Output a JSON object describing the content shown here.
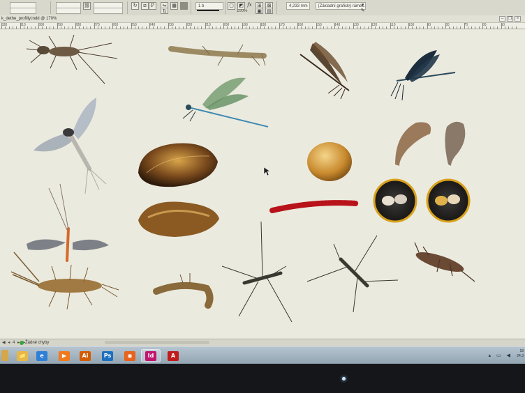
{
  "control_bar": {
    "stroke_weight": "1 b",
    "zoom_percent": "100%",
    "dimension": "4,233 mm",
    "frame_style": "[Základní grafický rámeč..."
  },
  "document": {
    "tab_title": "k_dethe_profilly.indd @ 170%"
  },
  "ruler": {
    "labels": [
      "330",
      "310",
      "300",
      "290",
      "280",
      "270",
      "260",
      "250",
      "240",
      "230",
      "220",
      "210",
      "200",
      "190",
      "180",
      "170",
      "160",
      "150",
      "140",
      "130",
      "120",
      "110",
      "100",
      "90",
      "80",
      "70",
      "60",
      "50"
    ]
  },
  "status": {
    "nav_arrows": "◀ ◂ 4 ▸ ▶",
    "preflight_label": "Žádné chyby"
  },
  "taskbar": {
    "apps": [
      {
        "name": "windows-explorer",
        "label": "📁",
        "color": "#e6b74a"
      },
      {
        "name": "internet-explorer",
        "label": "e",
        "color": "#2f7fd6"
      },
      {
        "name": "media-player",
        "label": "▶",
        "color": "#f07a1e"
      },
      {
        "name": "illustrator",
        "label": "Ai",
        "color": "#d35b00"
      },
      {
        "name": "photoshop",
        "label": "Ps",
        "color": "#1c6fbf"
      },
      {
        "name": "firefox",
        "label": "◉",
        "color": "#e8631b"
      },
      {
        "name": "indesign",
        "label": "Id",
        "color": "#c2156e"
      },
      {
        "name": "acrobat",
        "label": "A",
        "color": "#c01c1c"
      }
    ],
    "clock": "18\n24.3"
  },
  "colors": {
    "canvas": "#ebeadf",
    "taskbar": "#a6b6c2",
    "bezel": "#15161a"
  },
  "canvas_items": [
    {
      "name": "mayfly-nymph"
    },
    {
      "name": "stonefly-nymph"
    },
    {
      "name": "damselfly-brown"
    },
    {
      "name": "damselfly-blue"
    },
    {
      "name": "green-damselfly"
    },
    {
      "name": "mayfly-adult"
    },
    {
      "name": "freshwater-mussel-top"
    },
    {
      "name": "freshwater-mussel-bottom"
    },
    {
      "name": "snail-egg"
    },
    {
      "name": "bloodworm"
    },
    {
      "name": "leech-1"
    },
    {
      "name": "leech-2"
    },
    {
      "name": "ostracod-circle-1"
    },
    {
      "name": "ostracod-circle-2"
    },
    {
      "name": "stonefly-adult"
    },
    {
      "name": "stonefly-nymph-2"
    },
    {
      "name": "caddisfly-larva"
    },
    {
      "name": "water-strider-1"
    },
    {
      "name": "water-strider-2"
    },
    {
      "name": "dragonfly-nymph"
    }
  ]
}
